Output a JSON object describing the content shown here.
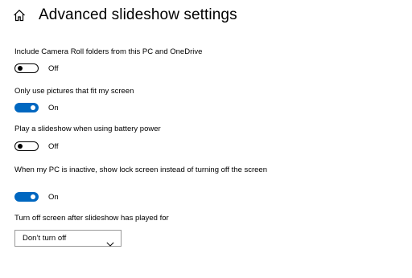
{
  "header": {
    "title": "Advanced slideshow settings",
    "home_icon": "home-icon"
  },
  "settings": [
    {
      "label": "Include Camera Roll folders from this PC and OneDrive",
      "state": "Off",
      "on": false
    },
    {
      "label": "Only use pictures that fit my screen",
      "state": "On",
      "on": true
    },
    {
      "label": "Play a slideshow when using battery power",
      "state": "Off",
      "on": false
    },
    {
      "label": "When my PC is inactive, show lock screen instead of turning off the screen",
      "state": "On",
      "on": true
    }
  ],
  "screen_off": {
    "label": "Turn off screen after slideshow has played for",
    "selected": "Don’t turn off"
  },
  "colors": {
    "accent": "#0067c0",
    "text": "#000000",
    "background": "#ffffff",
    "dropdown_border": "#999999"
  }
}
